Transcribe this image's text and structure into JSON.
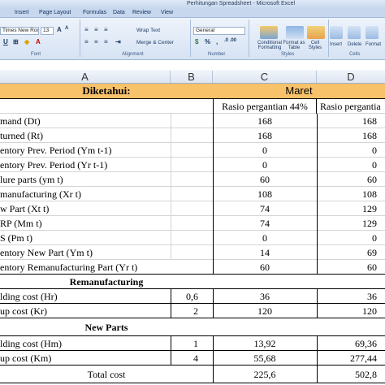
{
  "window": {
    "title": "Perhitungan Spreadsheet - Microsoft Excel"
  },
  "ribbon": {
    "tabs": [
      "Insert",
      "Page Layout",
      "Formulas",
      "Data",
      "Review",
      "View"
    ],
    "font_name": "Times New Rom",
    "font_size": "13",
    "wrap_text": "Wrap Text",
    "merge_center": "Merge & Center",
    "number_format": "General",
    "conditional_formatting": "Conditional Formatting",
    "format_as_table": "Format as Table",
    "cell_styles": "Cell Styles",
    "insert": "Insert",
    "delete": "Delete",
    "format": "Format",
    "groups": {
      "font": "Font",
      "alignment": "Alignment",
      "number": "Number",
      "styles": "Styles",
      "cells": "Cells"
    }
  },
  "columns": [
    "A",
    "B",
    "C",
    "D"
  ],
  "sheet": {
    "header": {
      "label": "Diketahui:",
      "month": "Maret"
    },
    "scenario_c": "Rasio pergantian 44%",
    "scenario_d": "Rasio pergantia",
    "rows": [
      {
        "a": "mand (Dt)",
        "c": "168",
        "d": "168"
      },
      {
        "a": "turned (Rt)",
        "c": "168",
        "d": "168"
      },
      {
        "a": "entory Prev. Period (Ym t-1)",
        "c": "0",
        "d": "0"
      },
      {
        "a": "entory Prev. Period (Yr t-1)",
        "c": "0",
        "d": "0"
      },
      {
        "a": "lure parts (ym t)",
        "c": "60",
        "d": "60"
      },
      {
        "a": "manufacturing (Xr t)",
        "c": "108",
        "d": "108"
      },
      {
        "a": "w Part (Xt t)",
        "c": "74",
        "d": "129"
      },
      {
        "a": "RP (Mm t)",
        "c": "74",
        "d": "129"
      },
      {
        "a": "S (Pm t)",
        "c": "0",
        "d": "0"
      },
      {
        "a": "entory New Part (Ym t)",
        "c": "14",
        "d": "69"
      },
      {
        "a": "entory Remanufacturing Part (Yr t)",
        "c": "60",
        "d": "60"
      }
    ],
    "reman_title": "Remanufacturing",
    "reman_rows": [
      {
        "a": "lding cost (Hr)",
        "b": "0,6",
        "c": "36",
        "d": "36"
      },
      {
        "a": "up cost (Kr)",
        "b": "2",
        "c": "120",
        "d": "120"
      }
    ],
    "new_title": "New Parts",
    "new_rows": [
      {
        "a": "lding cost (Hm)",
        "b": "1",
        "c": "13,92",
        "d": "69,36"
      },
      {
        "a": "up cost (Km)",
        "b": "4",
        "c": "55,68",
        "d": "277,44"
      }
    ],
    "total": {
      "a": "Total cost",
      "c": "225,6",
      "d": "502,8"
    }
  }
}
